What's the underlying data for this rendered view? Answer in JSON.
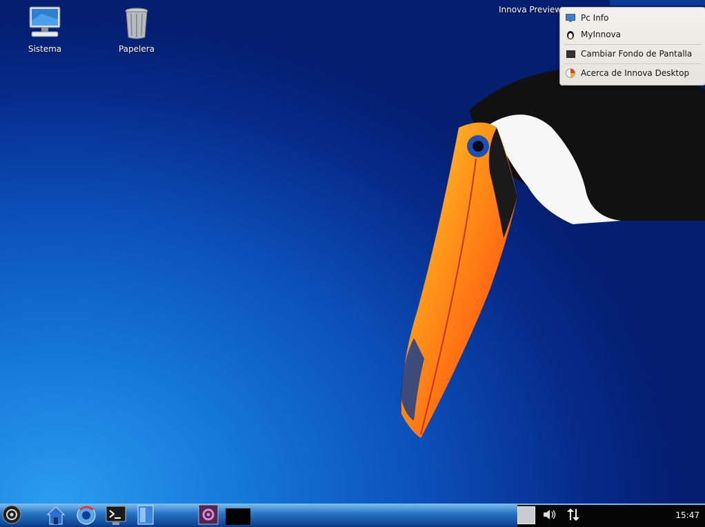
{
  "desktop": {
    "icons": [
      {
        "label": "Sistema",
        "icon": "computer-icon"
      },
      {
        "label": "Papelera",
        "icon": "trash-icon"
      }
    ],
    "top_label": "Innova Preview"
  },
  "context_menu": {
    "items": [
      {
        "label": "Pc Info",
        "icon": "monitor-icon"
      },
      {
        "label": "MyInnova",
        "icon": "tux-icon"
      },
      {
        "label": "Cambiar Fondo de Pantalla",
        "icon": "wallpaper-icon"
      },
      {
        "label": "Acerca de Innova Desktop",
        "icon": "innova-logo-icon"
      }
    ]
  },
  "taskbar": {
    "launchers": [
      "start-menu-icon",
      "home-icon",
      "browser-icon",
      "terminal-icon",
      "file-manager-icon",
      "settings-icon",
      "window-icon"
    ],
    "tray": {
      "clock": "15:47",
      "icons": [
        "workspace-icon",
        "volume-icon",
        "network-icon"
      ]
    }
  },
  "colors": {
    "accent": "#1478d8",
    "menu_bg": "#efece8",
    "taskbar_top": "#7ec0f0",
    "taskbar_bottom": "#0a3a8a"
  }
}
